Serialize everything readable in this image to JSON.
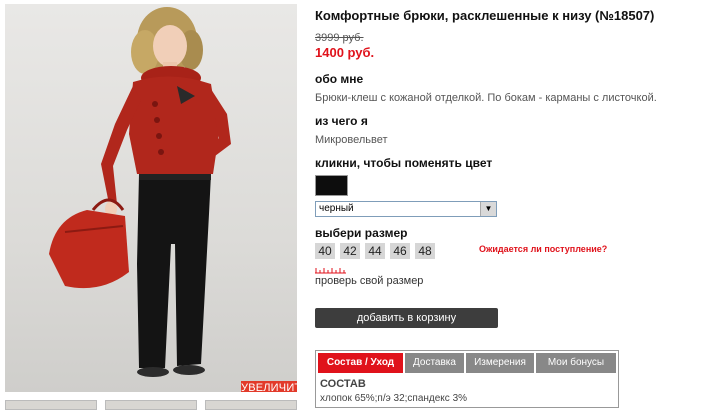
{
  "product": {
    "title": "Комфортные брюки, расклешенные к низу (№18507)",
    "old_price": "3999 руб.",
    "new_price": "1400 руб."
  },
  "photo": {
    "zoom_label": "УВЕЛИЧИТЬ"
  },
  "about": {
    "heading": "обо мне",
    "text": "Брюки-клеш с кожаной отделкой. По бокам - карманы с листочкой."
  },
  "material": {
    "heading": "из чего я",
    "text": "Микровельвет"
  },
  "color": {
    "heading": "кликни, чтобы поменять цвет",
    "swatch_color": "#0d0d0d",
    "selected": "черный"
  },
  "size": {
    "heading": "выбери размер",
    "options": [
      "40",
      "42",
      "44",
      "46",
      "48"
    ],
    "notify_link": "Ожидается ли поступление?",
    "check_link": "проверь свой размер"
  },
  "cart": {
    "button_label": "добавить в корзину"
  },
  "tabs": {
    "items": [
      {
        "label": "Состав / Уход",
        "active": true
      },
      {
        "label": "Доставка",
        "active": false
      },
      {
        "label": "Измерения",
        "active": false
      },
      {
        "label": "Мои бонусы",
        "active": false
      }
    ],
    "content_heading": "СОСТАВ",
    "content_text": "хлопок 65%;п/э 32;спандекс 3%"
  },
  "colors": {
    "accent": "#e0121b",
    "cart_button": "#3d3d3d",
    "size_box": "#d6d6d6"
  }
}
